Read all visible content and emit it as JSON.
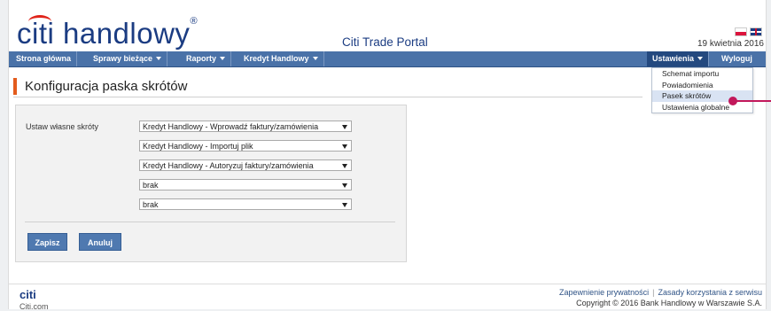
{
  "brand": {
    "logo_text": "citi handlowy",
    "portal_title": "Citi Trade Portal"
  },
  "header": {
    "date": "19 kwietnia 2016",
    "languages": [
      "pl-flag-icon",
      "uk-flag-icon"
    ]
  },
  "nav": {
    "items": [
      {
        "label": "Strona główna",
        "has_caret": false
      },
      {
        "label": "Sprawy bieżące",
        "has_caret": true
      },
      {
        "label": "Raporty",
        "has_caret": true
      },
      {
        "label": "Kredyt Handlowy",
        "has_caret": true
      }
    ],
    "settings_label": "Ustawienia",
    "logout_label": "Wyloguj"
  },
  "settings_menu": {
    "items": [
      "Schemat importu",
      "Powiadomienia",
      "Pasek skrótów",
      "Ustawienia globalne"
    ],
    "selected": "Pasek skrótów"
  },
  "page": {
    "title": "Konfiguracja paska skrótów"
  },
  "form": {
    "label": "Ustaw własne skróty",
    "shortcuts": [
      "Kredyt Handlowy - Wprowadź faktury/zamówienia",
      "Kredyt Handlowy - Importuj plik",
      "Kredyt Handlowy - Autoryzuj faktury/zamówienia",
      "brak",
      "brak"
    ],
    "save_label": "Zapisz",
    "cancel_label": "Anuluj"
  },
  "footer": {
    "logo": "citi",
    "site": "Citi.com",
    "privacy_link": "Zapewnienie prywatności",
    "terms_link": "Zasady korzystania z serwisu",
    "separator": "|",
    "copyright": "Copyright © 2016 Bank Handlowy w Warszawie S.A."
  },
  "colors": {
    "brand_blue": "#1b3c82",
    "nav_blue": "#4a72a8",
    "accent_orange": "#e35b1c",
    "pointer_magenta": "#c2185b"
  }
}
